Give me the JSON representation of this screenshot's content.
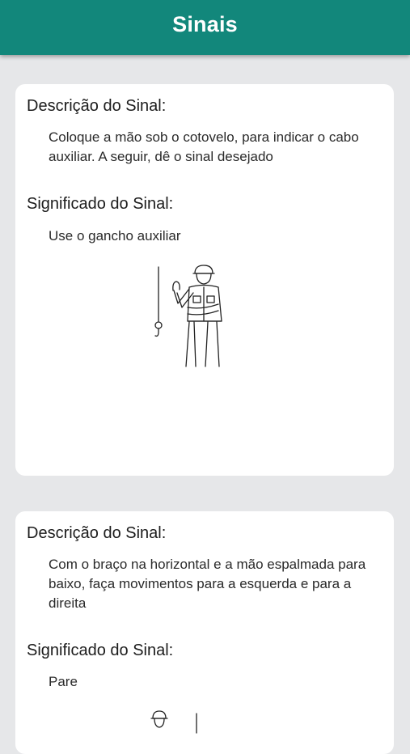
{
  "appbar": {
    "title": "Sinais"
  },
  "cards": [
    {
      "description_heading": "Descrição do Sinal:",
      "description": "Coloque a mão sob o cotovelo, para indicar o cabo auxiliar. A seguir, dê o sinal desejado",
      "meaning_heading": "Significado do Sinal:",
      "meaning": "Use o gancho auxiliar",
      "illustration_icon": "worker-auxiliary-hook-signal-icon"
    },
    {
      "description_heading": "Descrição do Sinal:",
      "description": "Com o braço na horizontal e a mão espalmada para baixo, faça movimentos para a esquerda e para a direita",
      "meaning_heading": "Significado do Sinal:",
      "meaning": "Pare",
      "illustration_icon": "worker-stop-signal-icon"
    }
  ],
  "colors": {
    "appbar": "#12877b",
    "background": "#e6e7e9",
    "card": "#ffffff"
  }
}
